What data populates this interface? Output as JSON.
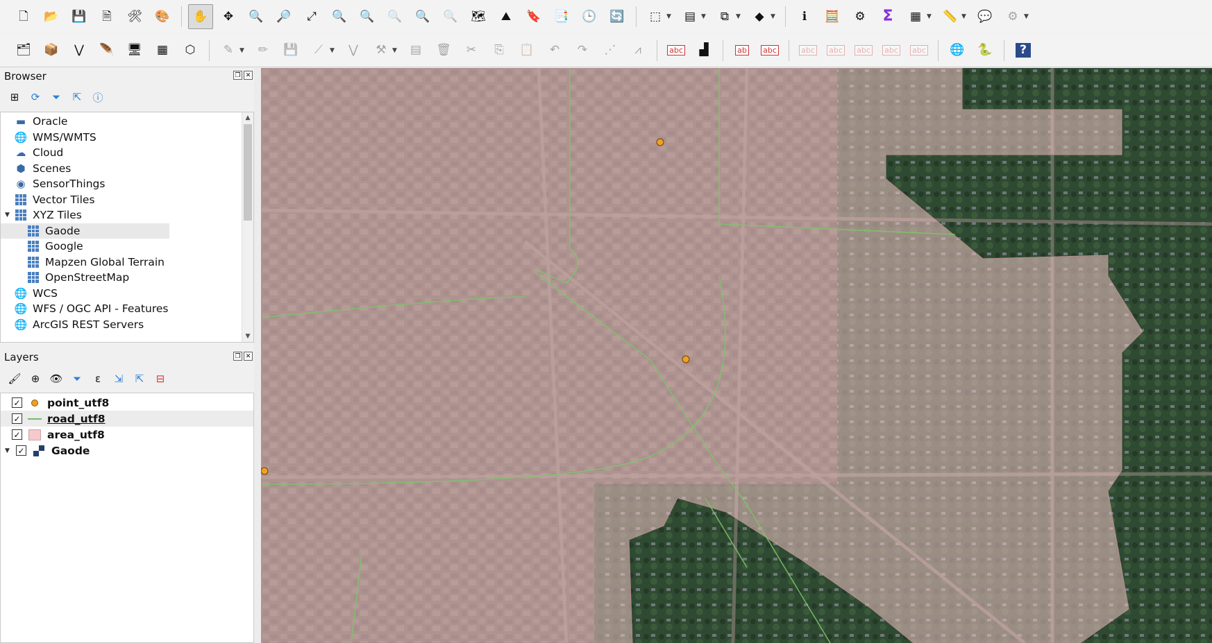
{
  "toolbar_row1": [
    {
      "name": "new-project-icon",
      "glyph": "🗋"
    },
    {
      "name": "open-project-icon",
      "glyph": "📂"
    },
    {
      "name": "save-project-icon",
      "glyph": "💾"
    },
    {
      "name": "new-print-layout-icon",
      "glyph": "🗎"
    },
    {
      "name": "layout-manager-icon",
      "glyph": "🛠"
    },
    {
      "name": "style-manager-icon",
      "glyph": "🎨"
    },
    {
      "name": "sep"
    },
    {
      "name": "pan-map-icon",
      "glyph": "✋",
      "active": true
    },
    {
      "name": "pan-to-selection-icon",
      "glyph": "✥"
    },
    {
      "name": "zoom-in-icon",
      "glyph": "🔍"
    },
    {
      "name": "zoom-out-icon",
      "glyph": "🔎"
    },
    {
      "name": "zoom-full-icon",
      "glyph": "⤢"
    },
    {
      "name": "zoom-to-selection-icon",
      "glyph": "🔍"
    },
    {
      "name": "zoom-to-layer-icon",
      "glyph": "🔍"
    },
    {
      "name": "zoom-native-icon",
      "glyph": "🔍",
      "dim": true
    },
    {
      "name": "zoom-last-icon",
      "glyph": "🔍"
    },
    {
      "name": "zoom-next-icon",
      "glyph": "🔍",
      "dim": true
    },
    {
      "name": "new-map-view-icon",
      "glyph": "🗺"
    },
    {
      "name": "new-3d-map-view-icon",
      "glyph": "⛰"
    },
    {
      "name": "new-bookmark-icon",
      "glyph": "🔖"
    },
    {
      "name": "show-bookmarks-icon",
      "glyph": "📑"
    },
    {
      "name": "temporal-controller-icon",
      "glyph": "🕒"
    },
    {
      "name": "refresh-icon",
      "glyph": "🔄"
    },
    {
      "name": "sep"
    },
    {
      "name": "select-features-icon",
      "glyph": "⬚",
      "dropdown": true
    },
    {
      "name": "select-by-value-icon",
      "glyph": "▤",
      "dropdown": true
    },
    {
      "name": "deselect-features-icon",
      "glyph": "⧉",
      "dropdown": true
    },
    {
      "name": "select-by-location-icon",
      "glyph": "◆",
      "dropdown": true
    },
    {
      "name": "sep"
    },
    {
      "name": "identify-features-icon",
      "glyph": "ℹ"
    },
    {
      "name": "open-field-calculator-icon",
      "glyph": "🧮"
    },
    {
      "name": "toolbox-icon",
      "glyph": "⚙"
    },
    {
      "name": "statistical-summary-icon",
      "glyph": "Σ"
    },
    {
      "name": "attribute-table-icon",
      "glyph": "▦",
      "dropdown": true
    },
    {
      "name": "measure-line-icon",
      "glyph": "📏",
      "dropdown": true
    },
    {
      "name": "map-tips-icon",
      "glyph": "💬"
    },
    {
      "name": "options-icon",
      "glyph": "⚙",
      "dim": true,
      "dropdown": true
    }
  ],
  "toolbar_row2": [
    {
      "name": "data-source-manager-icon",
      "glyph": "🗂"
    },
    {
      "name": "new-geopackage-layer-icon",
      "glyph": "📦"
    },
    {
      "name": "new-shapefile-layer-icon",
      "glyph": "⋁"
    },
    {
      "name": "new-temporary-layer-icon",
      "glyph": "🪶"
    },
    {
      "name": "new-virtual-layer-icon",
      "glyph": "🖥"
    },
    {
      "name": "new-mesh-layer-icon",
      "glyph": "▦"
    },
    {
      "name": "new-vector-tile-layer-icon",
      "glyph": "⬡"
    },
    {
      "name": "sep"
    },
    {
      "name": "current-edits-icon",
      "glyph": "✎",
      "dim": true,
      "dropdown": true
    },
    {
      "name": "toggle-editing-icon",
      "glyph": "✏",
      "dim": true
    },
    {
      "name": "save-layer-edits-icon",
      "glyph": "💾",
      "dim": true
    },
    {
      "name": "digitize-line-icon",
      "glyph": "⟋",
      "dim": true,
      "dropdown": true
    },
    {
      "name": "vertex-tool-icon",
      "glyph": "⋁",
      "dim": true
    },
    {
      "name": "modify-attributes-icon",
      "glyph": "⚒",
      "dim": true,
      "dropdown": true
    },
    {
      "name": "edit-attributes-icon",
      "glyph": "▤",
      "dim": true
    },
    {
      "name": "delete-selected-icon",
      "glyph": "🗑",
      "dim": true
    },
    {
      "name": "cut-features-icon",
      "glyph": "✂",
      "dim": true
    },
    {
      "name": "copy-features-icon",
      "glyph": "⎘",
      "dim": true
    },
    {
      "name": "paste-features-icon",
      "glyph": "📋",
      "dim": true
    },
    {
      "name": "undo-icon",
      "glyph": "↶",
      "dim": true
    },
    {
      "name": "redo-icon",
      "glyph": "↷",
      "dim": true
    },
    {
      "name": "digitize-shape-icon",
      "glyph": "⋰",
      "dim": true
    },
    {
      "name": "advanced-digitizing-icon",
      "glyph": "⩘",
      "dim": true
    },
    {
      "name": "sep"
    },
    {
      "name": "label-tool-icon",
      "glyph": "abc"
    },
    {
      "name": "diagram-tool-icon",
      "glyph": "▟"
    },
    {
      "name": "sep"
    },
    {
      "name": "pin-labels-icon",
      "glyph": "ab"
    },
    {
      "name": "show-hide-labels-icon",
      "glyph": "abc"
    },
    {
      "name": "sep"
    },
    {
      "name": "move-label-icon",
      "glyph": "abc",
      "dim": true
    },
    {
      "name": "rotate-label-icon",
      "glyph": "abc",
      "dim": true
    },
    {
      "name": "change-label-icon",
      "glyph": "abc",
      "dim": true
    },
    {
      "name": "label-properties-icon",
      "glyph": "abc",
      "dim": true
    },
    {
      "name": "move-diagram-icon",
      "glyph": "abc",
      "dim": true
    },
    {
      "name": "sep"
    },
    {
      "name": "plugin-globe-icon",
      "glyph": "🌐"
    },
    {
      "name": "python-console-icon",
      "glyph": "🐍"
    },
    {
      "name": "sep"
    },
    {
      "name": "help-icon",
      "glyph": "?"
    }
  ],
  "browser": {
    "title": "Browser",
    "items": [
      {
        "label": "Oracle",
        "icon": "oracle-icon",
        "glyph": "▬",
        "level": 0
      },
      {
        "label": "WMS/WMTS",
        "icon": "wms-globe-icon",
        "glyph": "🌐",
        "level": 0
      },
      {
        "label": "Cloud",
        "icon": "cloud-icon",
        "glyph": "☁",
        "level": 0
      },
      {
        "label": "Scenes",
        "icon": "scenes-cube-icon",
        "glyph": "⬢",
        "level": 0
      },
      {
        "label": "SensorThings",
        "icon": "sensor-icon",
        "glyph": "◉",
        "level": 0
      },
      {
        "label": "Vector Tiles",
        "icon": "vector-tiles-icon",
        "glyph": "grid",
        "level": 0
      },
      {
        "label": "XYZ Tiles",
        "icon": "xyz-tiles-icon",
        "glyph": "grid",
        "level": 0,
        "expanded": true
      },
      {
        "label": "Gaode",
        "icon": "xyz-tile-icon",
        "glyph": "grid",
        "level": 1,
        "selected": true
      },
      {
        "label": "Google",
        "icon": "xyz-tile-icon",
        "glyph": "grid",
        "level": 1
      },
      {
        "label": "Mapzen Global Terrain",
        "icon": "xyz-tile-icon",
        "glyph": "grid",
        "level": 1
      },
      {
        "label": "OpenStreetMap",
        "icon": "xyz-tile-icon",
        "glyph": "grid",
        "level": 1
      },
      {
        "label": "WCS",
        "icon": "wcs-globe-icon",
        "glyph": "🌐",
        "level": 0
      },
      {
        "label": "WFS / OGC API - Features",
        "icon": "wfs-icon",
        "glyph": "🌐",
        "level": 0
      },
      {
        "label": "ArcGIS REST Servers",
        "icon": "arcgis-icon",
        "glyph": "🌐",
        "level": 0
      }
    ]
  },
  "layers": {
    "title": "Layers",
    "items": [
      {
        "label": "point_utf8",
        "symbol": "point",
        "checked": true
      },
      {
        "label": "road_utf8",
        "symbol": "line",
        "checked": true,
        "selected": true,
        "underline": true
      },
      {
        "label": "area_utf8",
        "symbol": "polygon",
        "checked": true
      },
      {
        "label": "Gaode",
        "symbol": "tile",
        "checked": true,
        "expanded": true
      }
    ]
  },
  "map": {
    "basemap": "Gaode",
    "area_fill_color": "#f2c4c6",
    "road_color": "#7ec46a",
    "point_color": "#f0a020"
  }
}
